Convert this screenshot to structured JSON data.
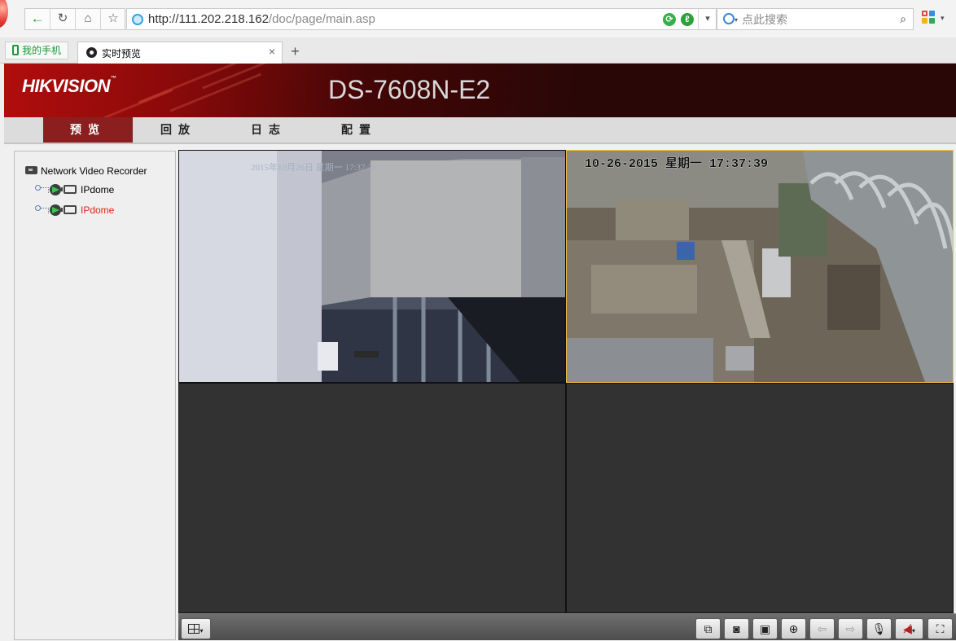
{
  "browser": {
    "address": {
      "url_host": "http://111.202.218.162",
      "url_path": "/doc/page/main.asp"
    },
    "search": {
      "placeholder": "点此搜索"
    },
    "favorites": [
      {
        "label": "我的手机"
      }
    ],
    "tabs": [
      {
        "title": "实时预览",
        "close": "×"
      }
    ],
    "new_tab": "+"
  },
  "app": {
    "brand": "HIKVISION",
    "brand_mark": "™",
    "model": "DS-7608N-E2",
    "nav": [
      {
        "label": "预览",
        "active": true
      },
      {
        "label": "回放",
        "active": false
      },
      {
        "label": "日志",
        "active": false
      },
      {
        "label": "配置",
        "active": false
      }
    ],
    "tree": {
      "root": "Network Video Recorder",
      "channels": [
        {
          "label": "IPdome",
          "color": "#000000"
        },
        {
          "label": "IPdome",
          "color": "#e0231b"
        }
      ]
    },
    "panes": [
      {
        "osd": "2015年10月26日 星期一 17:37:38",
        "has_video": true,
        "selected": false
      },
      {
        "osd": "10-26-2015 星期一 17:37:39",
        "has_video": true,
        "selected": true
      },
      {
        "osd": "",
        "has_video": false,
        "selected": false
      },
      {
        "osd": "",
        "has_video": false,
        "selected": false
      }
    ],
    "colors": {
      "header_red": "#8b1f1f",
      "selected_border": "#f0c040",
      "active_channel": "#e0231b"
    }
  }
}
